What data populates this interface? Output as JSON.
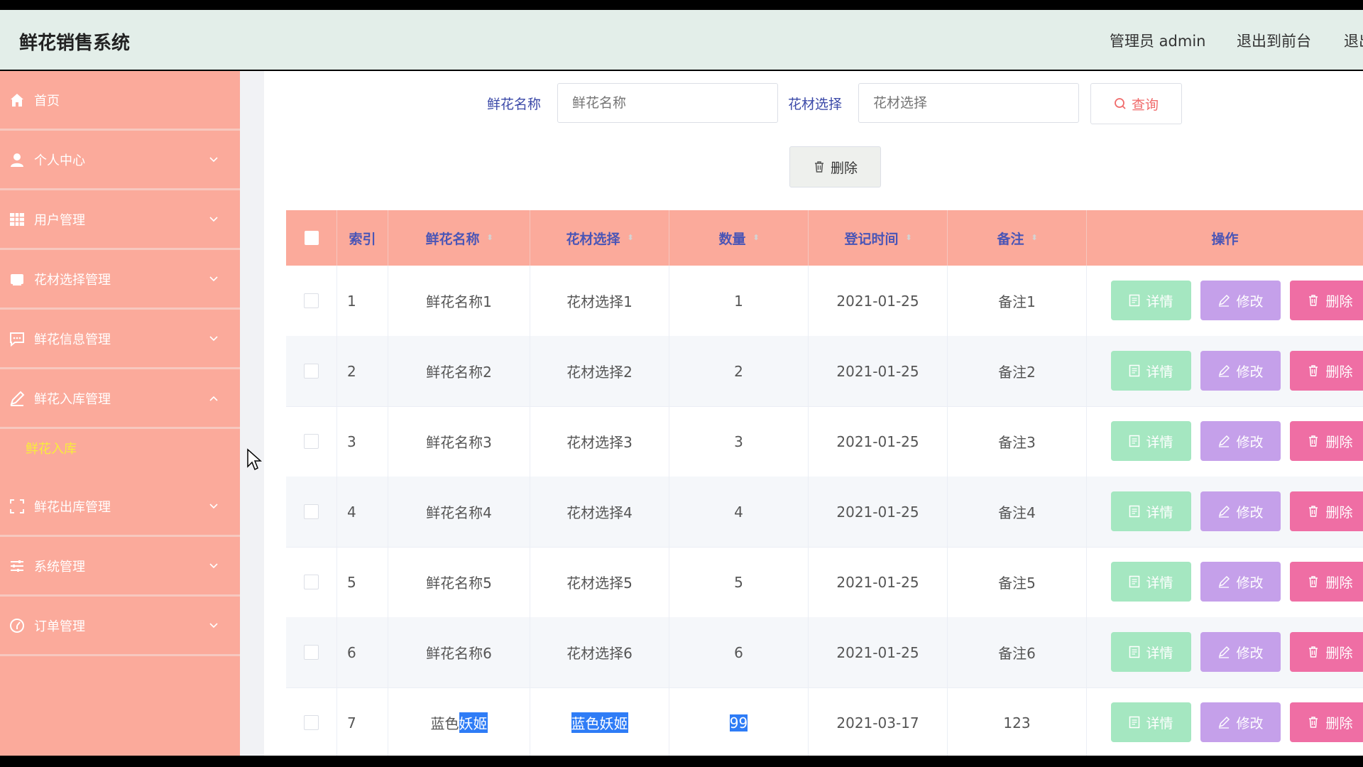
{
  "app": {
    "title": "鲜花销售系统"
  },
  "header": {
    "admin_label": "管理员 admin",
    "exit_front": "退出到前台",
    "logout": "退出登录"
  },
  "sidebar": {
    "items": [
      {
        "label": "首页",
        "icon": "home-icon"
      },
      {
        "label": "个人中心",
        "icon": "user-icon"
      },
      {
        "label": "用户管理",
        "icon": "grid-icon"
      },
      {
        "label": "花材选择管理",
        "icon": "folder-icon"
      },
      {
        "label": "鲜花信息管理",
        "icon": "message-icon"
      },
      {
        "label": "鲜花入库管理",
        "icon": "pen-icon"
      },
      {
        "label": "鲜花出库管理",
        "icon": "fullscreen-icon"
      },
      {
        "label": "系统管理",
        "icon": "sliders-icon"
      },
      {
        "label": "订单管理",
        "icon": "clock-icon"
      }
    ],
    "submenu_active": "鲜花入库"
  },
  "search": {
    "name_label": "鲜花名称",
    "name_placeholder": "鲜花名称",
    "material_label": "花材选择",
    "material_placeholder": "花材选择",
    "query_button": "查询"
  },
  "toolbar": {
    "delete_button": "删除"
  },
  "table": {
    "headers": {
      "index": "索引",
      "name": "鲜花名称",
      "material": "花材选择",
      "qty": "数量",
      "date": "登记时间",
      "note": "备注",
      "ops": "操作"
    },
    "actions": {
      "detail": "详情",
      "edit": "修改",
      "delete": "删除"
    },
    "rows": [
      {
        "index": "1",
        "name": "鲜花名称1",
        "material": "花材选择1",
        "qty": "1",
        "date": "2021-01-25",
        "note": "备注1"
      },
      {
        "index": "2",
        "name": "鲜花名称2",
        "material": "花材选择2",
        "qty": "2",
        "date": "2021-01-25",
        "note": "备注2"
      },
      {
        "index": "3",
        "name": "鲜花名称3",
        "material": "花材选择3",
        "qty": "3",
        "date": "2021-01-25",
        "note": "备注3"
      },
      {
        "index": "4",
        "name": "鲜花名称4",
        "material": "花材选择4",
        "qty": "4",
        "date": "2021-01-25",
        "note": "备注4"
      },
      {
        "index": "5",
        "name": "鲜花名称5",
        "material": "花材选择5",
        "qty": "5",
        "date": "2021-01-25",
        "note": "备注5"
      },
      {
        "index": "6",
        "name": "鲜花名称6",
        "material": "花材选择6",
        "qty": "6",
        "date": "2021-01-25",
        "note": "备注6"
      },
      {
        "index": "7",
        "name_prefix": "蓝色",
        "name_highlight": "妖姬",
        "material": "蓝色妖姬",
        "qty": "99",
        "date": "2021-03-17",
        "note": "123"
      }
    ]
  },
  "colors": {
    "sidebar": "#fbaa9b",
    "header_text": "#4a55b6",
    "detail": "#a5e7c1",
    "edit": "#c5a0ea",
    "delete": "#ef6ea4",
    "submenu_active": "#f7ee3a",
    "selection": "#2e7cf6"
  }
}
